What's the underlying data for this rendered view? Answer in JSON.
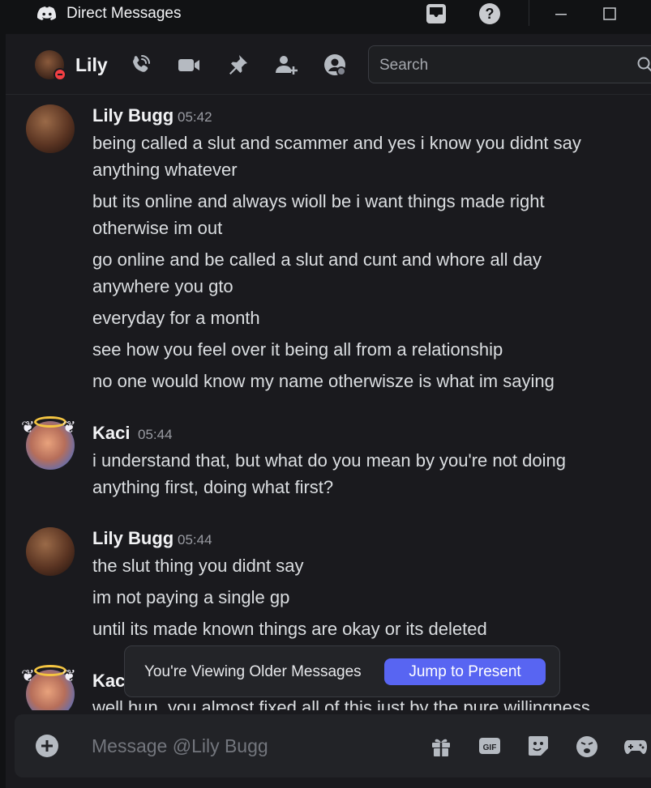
{
  "titlebar": {
    "title": "Direct Messages"
  },
  "header": {
    "name": "Lily",
    "search_placeholder": "Search",
    "icons": [
      "voice-call-icon",
      "video-call-icon",
      "pin-icon",
      "add-friend-icon",
      "user-profile-icon",
      "search-icon"
    ]
  },
  "messages": [
    {
      "author": "Lily Bugg",
      "time": "05:42",
      "lines": [
        "being called a slut and scammer and yes i know you didnt say",
        "anything whatever",
        "but its online and always wioll be i want things made right",
        "otherwise im out",
        "go online and be called a slut and cunt and whore all day",
        "anywhere you gto",
        "everyday for a month",
        "see how you feel over it being all from a relationship",
        "no one would know my name otherwisze is what im saying"
      ]
    },
    {
      "author": "Kaci",
      "time": "05:44",
      "lines": [
        "i understand that, but what do you mean by you're not doing",
        "anything first, doing what first?"
      ]
    },
    {
      "author": "Lily Bugg",
      "time": "05:44",
      "lines": [
        "the slut thing you didnt say",
        "im not paying a single gp",
        "until its made known things are okay or its deleted"
      ]
    },
    {
      "author": "Kac",
      "lines": [
        "well hun, you almost fixed all of this just by the pure willingness"
      ]
    }
  ],
  "older_bar": {
    "text": "You're Viewing Older Messages",
    "button": "Jump to Present"
  },
  "composer": {
    "placeholder": "Message @Lily Bugg",
    "icons": [
      "add-attachment-icon",
      "gift-icon",
      "gif-icon",
      "sticker-icon",
      "emoji-icon",
      "activities-icon"
    ]
  },
  "colors": {
    "accent": "#5865f2",
    "background": "#1a1a1e",
    "dnd": "#f23f43"
  }
}
